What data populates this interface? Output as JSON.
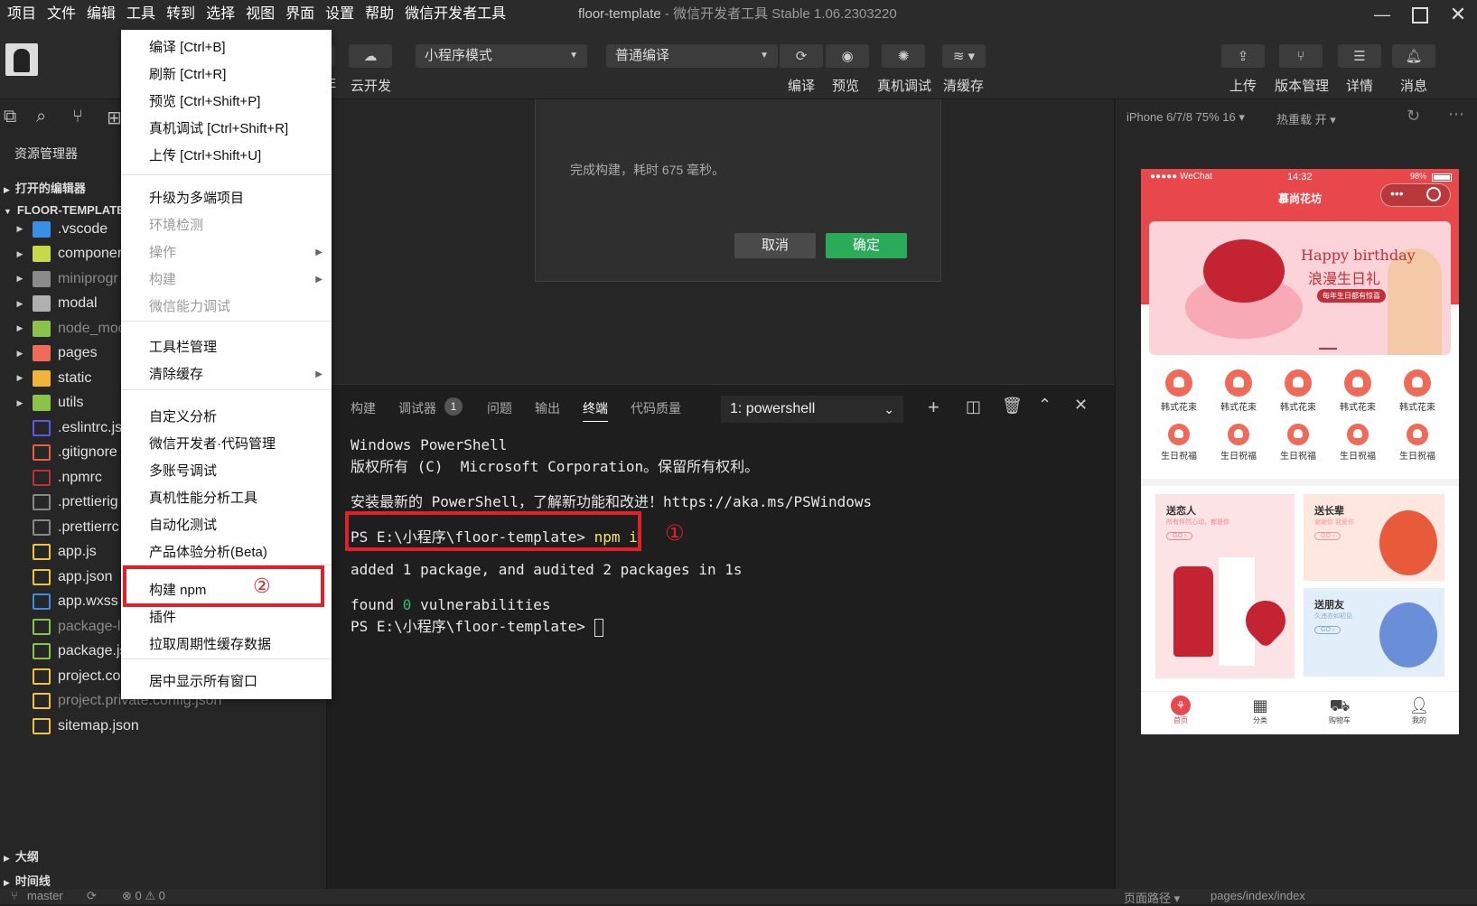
{
  "menubar": {
    "items": [
      "项目",
      "文件",
      "编辑",
      "工具",
      "转到",
      "选择",
      "视图",
      "界面",
      "设置",
      "帮助",
      "微信开发者工具"
    ],
    "title_main": "floor-template",
    "title_sep": " - ",
    "title_sub": "微信开发者工具 Stable 1.06.2303220"
  },
  "toolbar": {
    "mode_select": "小程序模式",
    "compile_select": "普通编译",
    "cloud_label": "云开发",
    "compile_label": "编译",
    "preview_label": "预览",
    "remote_debug_label": "真机调试",
    "clear_cache_label": "清缓存",
    "upload_label": "上传",
    "version_label": "版本管理",
    "details_label": "详情",
    "messages_label": "消息",
    "partial_label": "E"
  },
  "sidebar": {
    "explorer_title": "资源管理器",
    "open_editors": "打开的编辑器",
    "project_root": "FLOOR-TEMPLATE",
    "outline": "大纲",
    "timeline": "时间线",
    "items": [
      {
        "name": ".vscode",
        "type": "folder",
        "icon_color": "#3b8ee8",
        "dim": false
      },
      {
        "name": "componer",
        "type": "folder",
        "icon_color": "#c6d94a",
        "dim": false
      },
      {
        "name": "miniprogr",
        "type": "folder",
        "icon_color": "#8a8a8a",
        "dim": true
      },
      {
        "name": "modal",
        "type": "folder",
        "icon_color": "#b0b0b0",
        "dim": false
      },
      {
        "name": "node_moc",
        "type": "folder",
        "icon_color": "#8bc34a",
        "dim": true
      },
      {
        "name": "pages",
        "type": "folder",
        "icon_color": "#f06a5a",
        "dim": false
      },
      {
        "name": "static",
        "type": "folder",
        "icon_color": "#f0b43c",
        "dim": false
      },
      {
        "name": "utils",
        "type": "folder",
        "icon_color": "#8bc34a",
        "dim": false
      },
      {
        "name": ".eslintrc.js",
        "type": "file",
        "icon_color": "#5a5ae8",
        "dim": false
      },
      {
        "name": ".gitignore",
        "type": "file",
        "icon_color": "#e8613a",
        "dim": false
      },
      {
        "name": ".npmrc",
        "type": "file",
        "icon_color": "#c0303a",
        "dim": false
      },
      {
        "name": ".prettierig",
        "type": "file",
        "icon_color": "#888888",
        "dim": false
      },
      {
        "name": ".prettierrc",
        "type": "file",
        "icon_color": "#888888",
        "dim": false
      },
      {
        "name": "app.js",
        "type": "file",
        "icon_color": "#f0c43c",
        "dim": false
      },
      {
        "name": "app.json",
        "type": "file",
        "icon_color": "#f0c43c",
        "dim": false
      },
      {
        "name": "app.wxss",
        "type": "file",
        "icon_color": "#3b8ee8",
        "dim": false
      },
      {
        "name": "package-l",
        "type": "file",
        "icon_color": "#8bc34a",
        "dim": true
      },
      {
        "name": "package.js",
        "type": "file",
        "icon_color": "#8bc34a",
        "dim": false
      },
      {
        "name": "project.co",
        "type": "file",
        "icon_color": "#f0c43c",
        "dim": false
      },
      {
        "name": "project.private.config.json",
        "type": "file",
        "icon_color": "#f0c43c",
        "dim": true
      },
      {
        "name": "sitemap.json",
        "type": "file",
        "icon_color": "#f0c43c",
        "dim": false
      }
    ]
  },
  "tools_menu": {
    "items": [
      {
        "label": "编译  [Ctrl+B]",
        "disabled": false,
        "submenu": false
      },
      {
        "label": "刷新  [Ctrl+R]",
        "disabled": false,
        "submenu": false
      },
      {
        "label": "预览  [Ctrl+Shift+P]",
        "disabled": false,
        "submenu": false
      },
      {
        "label": "真机调试  [Ctrl+Shift+R]",
        "disabled": false,
        "submenu": false
      },
      {
        "label": "上传  [Ctrl+Shift+U]",
        "disabled": false,
        "submenu": false
      },
      {
        "label": "升级为多端项目",
        "disabled": false,
        "submenu": false
      },
      {
        "label": "环境检测",
        "disabled": true,
        "submenu": false
      },
      {
        "label": "操作",
        "disabled": true,
        "submenu": true
      },
      {
        "label": "构建",
        "disabled": true,
        "submenu": true
      },
      {
        "label": "微信能力调试",
        "disabled": true,
        "submenu": false
      },
      {
        "label": "工具栏管理",
        "disabled": false,
        "submenu": false
      },
      {
        "label": "清除缓存",
        "disabled": false,
        "submenu": true
      },
      {
        "label": "自定义分析",
        "disabled": false,
        "submenu": false
      },
      {
        "label": "微信开发者·代码管理",
        "disabled": false,
        "submenu": false
      },
      {
        "label": "多账号调试",
        "disabled": false,
        "submenu": false
      },
      {
        "label": "真机性能分析工具",
        "disabled": false,
        "submenu": false
      },
      {
        "label": "自动化测试",
        "disabled": false,
        "submenu": false
      },
      {
        "label": "产品体验分析(Beta)",
        "disabled": false,
        "submenu": false
      },
      {
        "label": "构建 npm",
        "disabled": false,
        "submenu": false
      },
      {
        "label": "插件",
        "disabled": false,
        "submenu": false
      },
      {
        "label": "拉取周期性缓存数据",
        "disabled": false,
        "submenu": false
      },
      {
        "label": "居中显示所有窗口",
        "disabled": false,
        "submenu": false
      }
    ],
    "annotation": "②"
  },
  "dialog": {
    "message": "完成构建，耗时 675 毫秒。",
    "cancel": "取消",
    "confirm": "确定"
  },
  "panel": {
    "tabs": [
      "构建",
      "调试器",
      "问题",
      "输出",
      "终端",
      "代码质量"
    ],
    "debugger_badge": "1",
    "active_tab": "终端",
    "shell_select": "1: powershell",
    "terminal": {
      "line1": "Windows PowerShell",
      "line2": "版权所有 (C)  Microsoft Corporation。保留所有权利。",
      "line3": "安装最新的 PowerShell，了解新功能和改进！https://aka.ms/PSWindows",
      "prompt": "PS E:\\小程序\\floor-template> ",
      "cmd": "npm i",
      "line5": "added 1 package, and audited 2 packages in 1s",
      "line6a": "found ",
      "line6b": "0",
      "line6c": " vulnerabilities",
      "line7": "PS E:\\小程序\\floor-template> "
    },
    "annotation": "①"
  },
  "simulator": {
    "device": "iPhone 6/7/8 75% 16 ▾",
    "hot_reload": "热重载 开 ▾",
    "status_carrier": "●●●●● WeChat",
    "status_time": "14:32",
    "status_battery": "98%",
    "nav_title": "慕尚花坊",
    "banner_title": "Happy birthday",
    "banner_sub": "浪漫生日礼",
    "banner_pill": "每年生日都有惊喜",
    "grid_row1": [
      "韩式花束",
      "韩式花束",
      "韩式花束",
      "韩式花束",
      "韩式花束"
    ],
    "grid_row2": [
      "生日祝福",
      "生日祝福",
      "生日祝福",
      "生日祝福",
      "生日祝福"
    ],
    "cards": [
      {
        "title": "送恋人",
        "sub": "所有怦然心动，都是你",
        "btn": "GO ›"
      },
      {
        "title": "送长辈",
        "sub": "谢谢你 我爱你",
        "btn": "GO ›"
      },
      {
        "title": "送朋友",
        "sub": "久违亦如初见",
        "btn": "GO ›"
      }
    ],
    "tabbar": [
      "首页",
      "分类",
      "购物车",
      "我的"
    ],
    "accent": "#e8474c"
  },
  "statusbar": {
    "branch": "master",
    "problems": "⊗ 0 ⚠ 0",
    "page_path_label": "页面路径 ▾",
    "page_path": "pages/index/index"
  }
}
